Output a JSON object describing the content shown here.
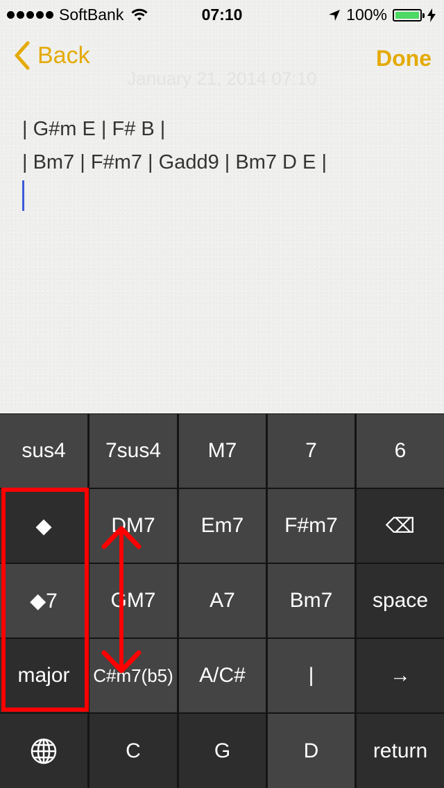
{
  "status_bar": {
    "carrier": "SoftBank",
    "time": "07:10",
    "battery": "100%",
    "battery_level": 1.0
  },
  "nav": {
    "back_label": "Back",
    "done_label": "Done",
    "date_text": "January 21, 2014 07:10"
  },
  "note": {
    "lines": [
      "| G#m E | F# B |",
      "| Bm7 | F#m7 | Gadd9 | Bm7 D E |"
    ]
  },
  "keyboard": {
    "rows": [
      [
        "sus4",
        "7sus4",
        "M7",
        "7",
        "6"
      ],
      [
        "◆",
        "DM7",
        "Em7",
        "F#m7",
        "⌫"
      ],
      [
        "◆7",
        "GM7",
        "A7",
        "Bm7",
        "space"
      ],
      [
        "major",
        "C#m7(b5)",
        "A/C#",
        "|",
        "→"
      ],
      [
        "globe",
        "C",
        "G",
        "D",
        "return"
      ]
    ],
    "icons": {
      "globe": "globe-icon",
      "delete": "delete-icon"
    }
  },
  "colors": {
    "accent": "#e4aa05",
    "key_light": "#444444",
    "key_dark": "#2d2d2d",
    "highlight": "#ff0000",
    "cursor": "#3b5bdb"
  }
}
